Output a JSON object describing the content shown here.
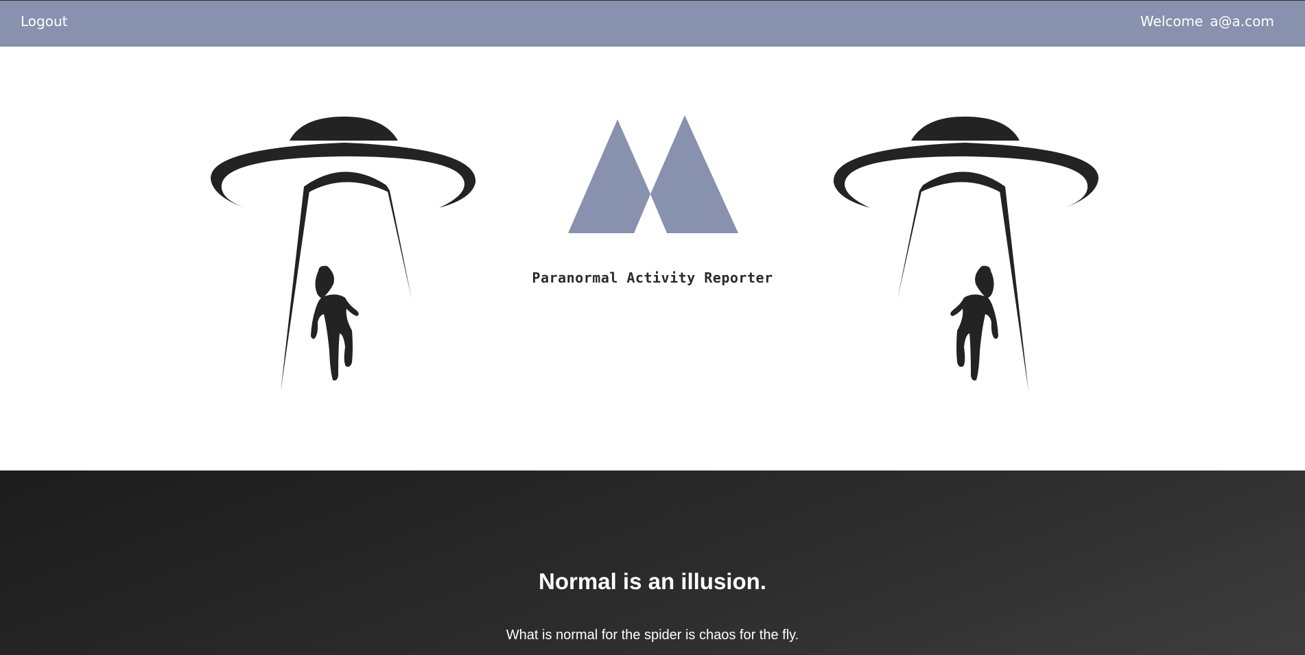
{
  "header": {
    "logout_label": "Logout",
    "welcome_label": "Welcome",
    "user_email": "a@a.com"
  },
  "brand": {
    "title": "Paranormal Activity Reporter"
  },
  "hero_section": {
    "icons": [
      "ufo-abduction-icon",
      "logo-peaks-icon"
    ]
  },
  "tagline": {
    "headline": "Normal is an illusion.",
    "subline": "What is normal for the spider is chaos for the fly."
  },
  "colors": {
    "accent": "#8891ad",
    "dark": "#222222",
    "white": "#ffffff"
  }
}
